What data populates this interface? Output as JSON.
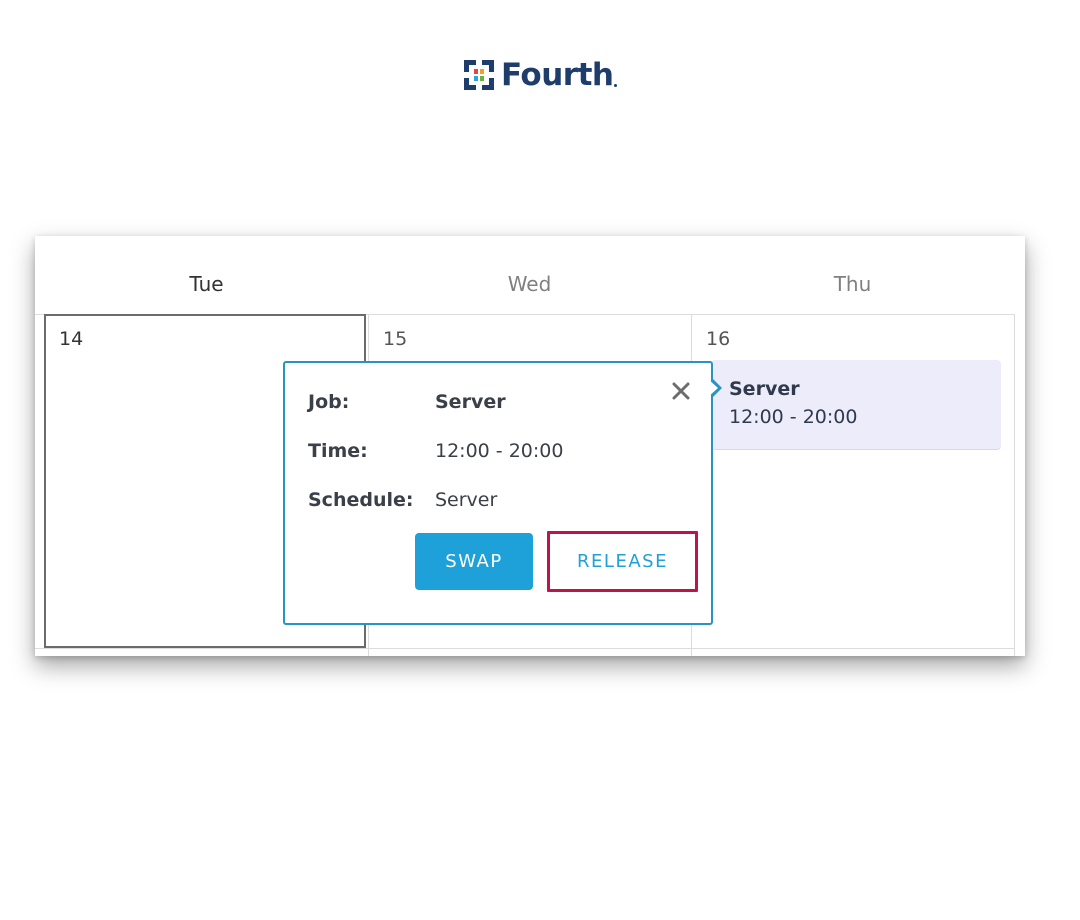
{
  "logo": {
    "text": "Fourth",
    "mark_icon": "fourth-logo-mark-icon"
  },
  "calendar": {
    "days": [
      {
        "label": "Tue",
        "date": "14"
      },
      {
        "label": "Wed",
        "date": "15"
      },
      {
        "label": "Thu",
        "date": "16"
      }
    ],
    "shift": {
      "title": "Server",
      "time": "12:00 - 20:00"
    }
  },
  "popover": {
    "rows": [
      {
        "label": "Job:",
        "value": "Server"
      },
      {
        "label": "Time:",
        "value": "12:00 - 20:00"
      },
      {
        "label": "Schedule:",
        "value": "Server"
      }
    ],
    "close_icon": "close-icon",
    "swap_label": "SWAP",
    "release_label": "RELEASE"
  },
  "colors": {
    "brand_navy": "#1e3d6b",
    "accent_blue": "#1ea1d9",
    "popover_border": "#2a93c6",
    "highlight_red": "#c2124a",
    "shift_bg": "#ececfa"
  }
}
